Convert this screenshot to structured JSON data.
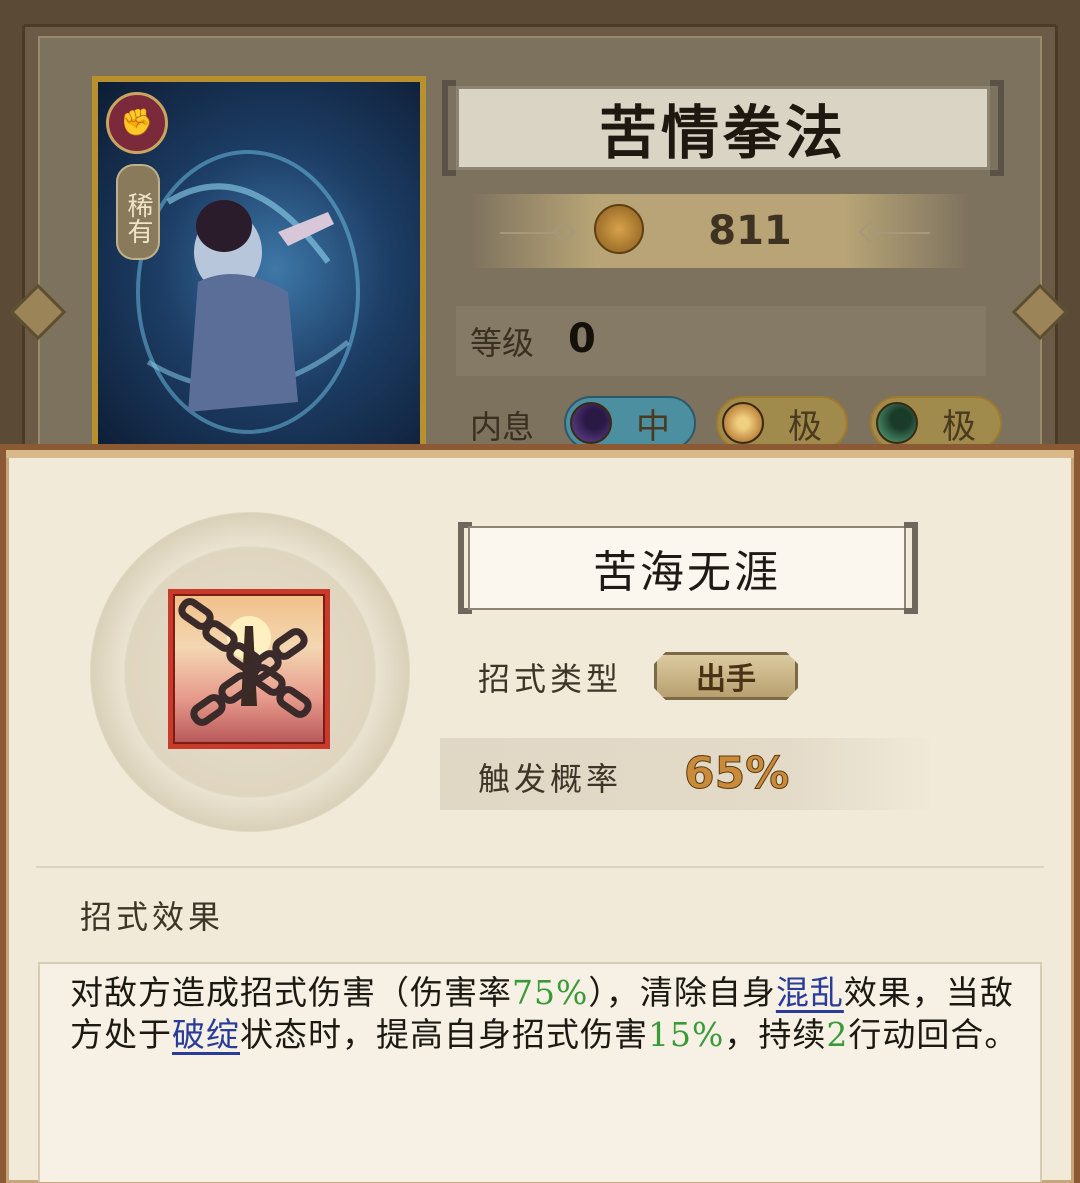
{
  "card": {
    "rarity": "稀有",
    "element_icon": "fist-icon",
    "title": "苦情拳法",
    "power": "811",
    "level_label": "等级",
    "level_value": "0",
    "inner_label": "内息",
    "inner_slots": [
      {
        "icon": "moon-orb-icon",
        "grade": "中"
      },
      {
        "icon": "sun-orb-icon",
        "grade": "极"
      },
      {
        "icon": "jade-orb-icon",
        "grade": "极"
      }
    ]
  },
  "skill": {
    "name": "苦海无涯",
    "icon": "chains-icon",
    "type_label": "招式类型",
    "type_value": "出手",
    "prob_label": "触发概率",
    "prob_value": "65%",
    "effect_heading": "招式效果",
    "effect": {
      "p1": "对敌方造成招式伤害（伤害率",
      "dmg_rate": "75%",
      "p2": "），清除自身",
      "kw_confuse": "混乱",
      "p3": "效果，当敌方处于",
      "kw_flaw": "破绽",
      "p4": "状态时，提高自身招式伤害",
      "bonus": "15%",
      "p5": "，持续",
      "turns": "2",
      "p6": "行动回合。"
    }
  },
  "colors": {
    "highlight_green": "#3a9a3a",
    "keyword_blue": "#2a3c9a",
    "skill_frame_red": "#c93a2a",
    "card_gold": "#b8902e"
  }
}
